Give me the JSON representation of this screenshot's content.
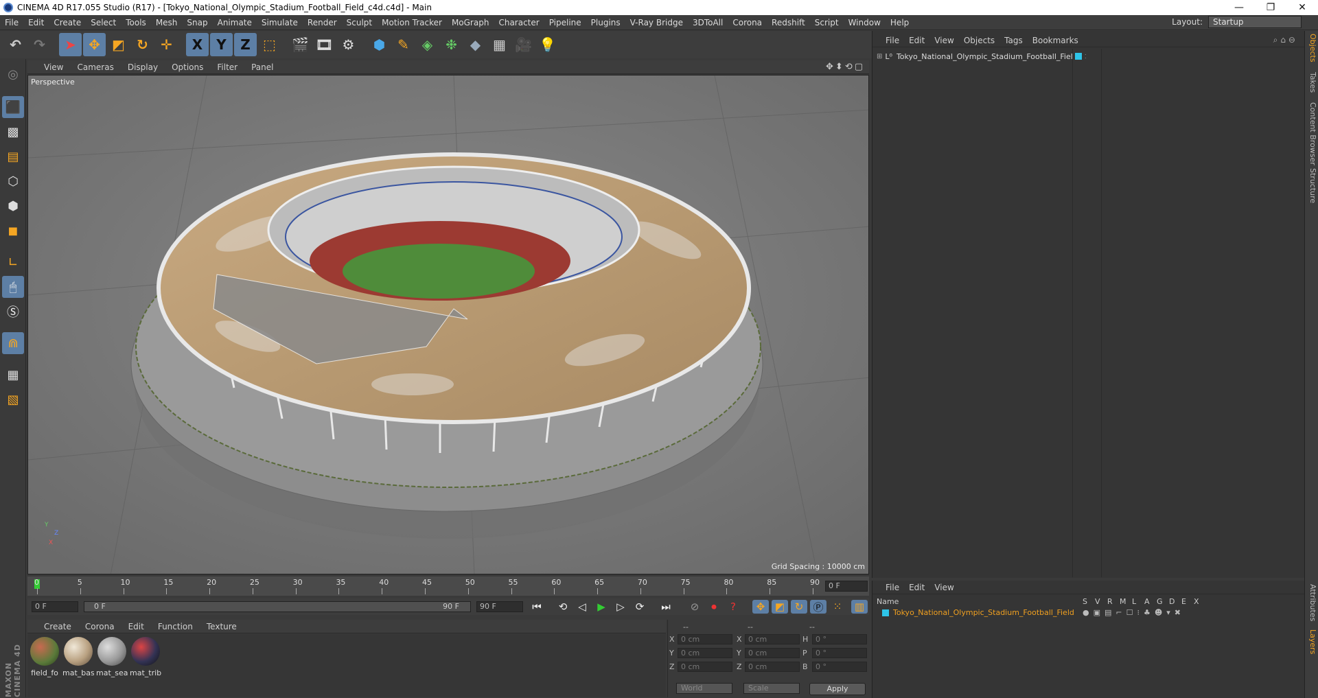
{
  "window": {
    "title": "CINEMA 4D R17.055 Studio (R17) - [Tokyo_National_Olympic_Stadium_Football_Field_c4d.c4d] - Main",
    "minimize": "—",
    "restore": "❐",
    "close": "✕"
  },
  "menubar": {
    "items": [
      "File",
      "Edit",
      "Create",
      "Select",
      "Tools",
      "Mesh",
      "Snap",
      "Animate",
      "Simulate",
      "Render",
      "Sculpt",
      "Motion Tracker",
      "MoGraph",
      "Character",
      "Pipeline",
      "Plugins",
      "V-Ray Bridge",
      "3DToAll",
      "Corona",
      "Redshift",
      "Script",
      "Window",
      "Help"
    ],
    "layout_label": "Layout:",
    "layout_value": "Startup"
  },
  "toolbar": {
    "x_label": "X",
    "y_label": "Y",
    "z_label": "Z"
  },
  "viewport": {
    "menu": [
      "View",
      "Cameras",
      "Display",
      "Options",
      "Filter",
      "Panel"
    ],
    "label": "Perspective",
    "grid_spacing": "Grid Spacing : 10000 cm",
    "axis_y": "Y",
    "axis_z": "Z",
    "axis_x": "X"
  },
  "timeline": {
    "ticks": [
      "0",
      "5",
      "10",
      "15",
      "20",
      "25",
      "30",
      "35",
      "40",
      "45",
      "50",
      "55",
      "60",
      "65",
      "70",
      "75",
      "80",
      "85",
      "90"
    ],
    "frame_display": "0 F",
    "start": "0 F",
    "range_start": "0 F",
    "range_end": "90 F",
    "end": "90 F"
  },
  "materials": {
    "menu": [
      "Create",
      "Corona",
      "Edit",
      "Function",
      "Texture"
    ],
    "items": [
      {
        "name": "field_fo"
      },
      {
        "name": "mat_bas"
      },
      {
        "name": "mat_sea"
      },
      {
        "name": "mat_trib"
      }
    ]
  },
  "coords": {
    "header": [
      "--",
      "--",
      "--"
    ],
    "rows": [
      {
        "a": "X",
        "av": "0 cm",
        "b": "X",
        "bv": "0 cm",
        "c": "H",
        "cv": "0 °"
      },
      {
        "a": "Y",
        "av": "0 cm",
        "b": "Y",
        "bv": "0 cm",
        "c": "P",
        "cv": "0 °"
      },
      {
        "a": "Z",
        "av": "0 cm",
        "b": "Z",
        "bv": "0 cm",
        "c": "B",
        "cv": "0 °"
      }
    ],
    "world": "World",
    "scale": "Scale",
    "apply": "Apply"
  },
  "objects": {
    "menu": [
      "File",
      "Edit",
      "View",
      "Objects",
      "Tags",
      "Bookmarks"
    ],
    "item": "Tokyo_National_Olympic_Stadium_Football_Field",
    "tag_color": "#2ec4e8"
  },
  "layers": {
    "menu": [
      "File",
      "Edit",
      "View"
    ],
    "name_col": "Name",
    "cols": [
      "S",
      "V",
      "R",
      "M",
      "L",
      "A",
      "G",
      "D",
      "E",
      "X"
    ],
    "item": "Tokyo_National_Olympic_Stadium_Football_Field",
    "item_color": "#f0a020"
  },
  "right_tabs": [
    "Objects",
    "Takes",
    "Content Browser",
    "Structure",
    "Attributes",
    "Layers"
  ],
  "maxon": "MAXON CINEMA 4D"
}
